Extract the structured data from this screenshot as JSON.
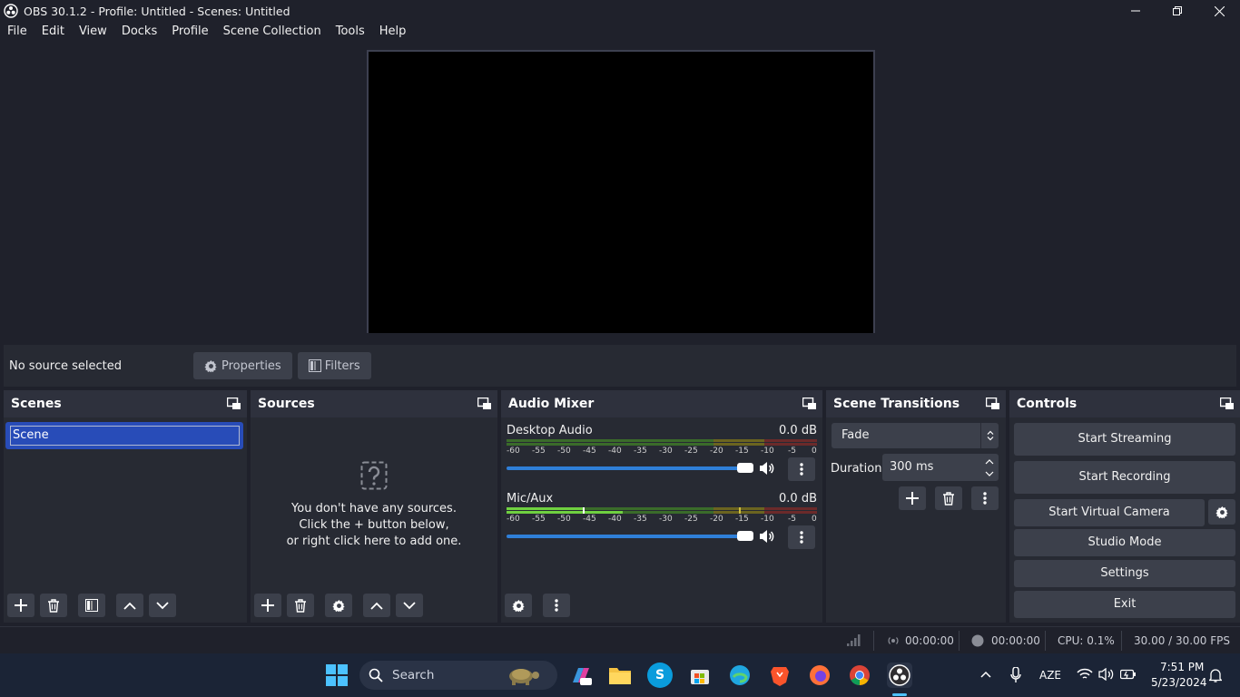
{
  "window": {
    "title": "OBS 30.1.2 - Profile: Untitled - Scenes: Untitled"
  },
  "menu": [
    "File",
    "Edit",
    "View",
    "Docks",
    "Profile",
    "Scene Collection",
    "Tools",
    "Help"
  ],
  "source_toolbar": {
    "status": "No source selected",
    "properties": "Properties",
    "filters": "Filters"
  },
  "scenes": {
    "title": "Scenes",
    "items": [
      "Scene"
    ]
  },
  "sources": {
    "title": "Sources",
    "empty_line1": "You don't have any sources.",
    "empty_line2": "Click the + button below,",
    "empty_line3": "or right click here to add one."
  },
  "mixer": {
    "title": "Audio Mixer",
    "ticks": [
      "-60",
      "-55",
      "-50",
      "-45",
      "-40",
      "-35",
      "-30",
      "-25",
      "-20",
      "-15",
      "-10",
      "-5",
      "0"
    ],
    "channels": [
      {
        "name": "Desktop Audio",
        "level": "0.0 dB",
        "volume": 1.0
      },
      {
        "name": "Mic/Aux",
        "level": "0.0 dB",
        "volume": 1.0
      }
    ]
  },
  "transitions": {
    "title": "Scene Transitions",
    "selected": "Fade",
    "duration_label": "Duration",
    "duration_value": "300 ms"
  },
  "controls": {
    "title": "Controls",
    "start_streaming": "Start Streaming",
    "start_recording": "Start Recording",
    "start_virtual_camera": "Start Virtual Camera",
    "studio_mode": "Studio Mode",
    "settings": "Settings",
    "exit": "Exit"
  },
  "status": {
    "stream_time": "00:00:00",
    "record_time": "00:00:00",
    "cpu": "CPU: 0.1%",
    "fps": "30.00 / 30.00 FPS"
  },
  "taskbar": {
    "search": "Search",
    "language": "AZE",
    "time": "7:51 PM",
    "date": "5/23/2024"
  },
  "colors": {
    "background": "#1f212b",
    "dock": "#272a33",
    "button": "#3c404b",
    "selection": "#284cb8",
    "slider": "#2f7fd8"
  }
}
